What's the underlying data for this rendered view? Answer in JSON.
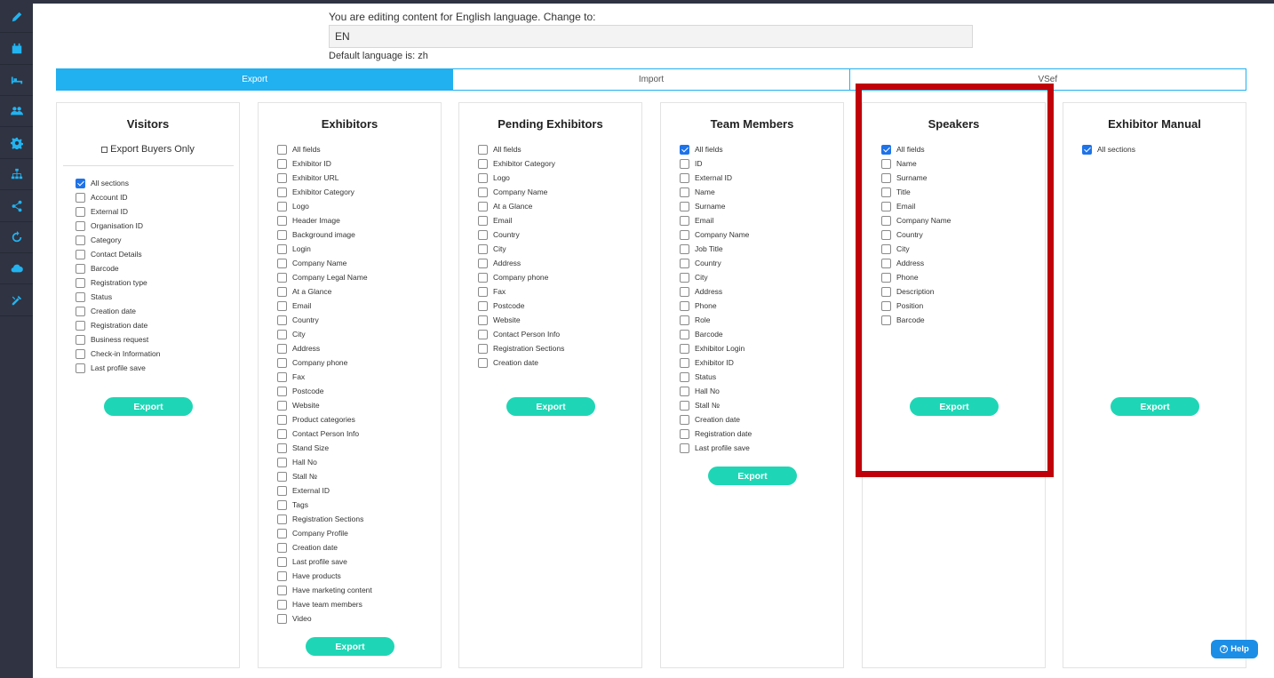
{
  "sidebar": {
    "items": [
      {
        "icon": "pencil-icon"
      },
      {
        "icon": "calendar-icon"
      },
      {
        "icon": "bed-icon"
      },
      {
        "icon": "users-icon"
      },
      {
        "icon": "gear-icon"
      },
      {
        "icon": "sitemap-icon"
      },
      {
        "icon": "share-icon"
      },
      {
        "icon": "refresh-icon"
      },
      {
        "icon": "cloud-upload-icon"
      },
      {
        "icon": "tools-icon"
      }
    ]
  },
  "language": {
    "editing_text": "You are editing content for English language. Change to:",
    "current_value": "EN",
    "default_text": "Default language is: zh"
  },
  "tabs": [
    {
      "label": "Export",
      "active": true
    },
    {
      "label": "Import",
      "active": false
    },
    {
      "label": "VSef",
      "active": false
    }
  ],
  "panels": [
    {
      "key": "visitors",
      "title": "Visitors",
      "buyers_only_label": "Export Buyers Only",
      "fields": [
        {
          "label": "All sections",
          "checked": true
        },
        {
          "label": "Account ID",
          "checked": false
        },
        {
          "label": "External ID",
          "checked": false
        },
        {
          "label": "Organisation ID",
          "checked": false
        },
        {
          "label": "Category",
          "checked": false
        },
        {
          "label": "Contact Details",
          "checked": false
        },
        {
          "label": "Barcode",
          "checked": false
        },
        {
          "label": "Registration type",
          "checked": false
        },
        {
          "label": "Status",
          "checked": false
        },
        {
          "label": "Creation date",
          "checked": false
        },
        {
          "label": "Registration date",
          "checked": false
        },
        {
          "label": "Business request",
          "checked": false
        },
        {
          "label": "Check-in Information",
          "checked": false
        },
        {
          "label": "Last profile save",
          "checked": false
        }
      ],
      "export_label": "Export"
    },
    {
      "key": "exhibitors",
      "title": "Exhibitors",
      "fields": [
        {
          "label": "All fields",
          "checked": false
        },
        {
          "label": "Exhibitor ID",
          "checked": false
        },
        {
          "label": "Exhibitor URL",
          "checked": false
        },
        {
          "label": "Exhibitor Category",
          "checked": false
        },
        {
          "label": "Logo",
          "checked": false
        },
        {
          "label": "Header Image",
          "checked": false
        },
        {
          "label": "Background image",
          "checked": false
        },
        {
          "label": "Login",
          "checked": false
        },
        {
          "label": "Company Name",
          "checked": false
        },
        {
          "label": "Company Legal Name",
          "checked": false
        },
        {
          "label": "At a Glance",
          "checked": false
        },
        {
          "label": "Email",
          "checked": false
        },
        {
          "label": "Country",
          "checked": false
        },
        {
          "label": "City",
          "checked": false
        },
        {
          "label": "Address",
          "checked": false
        },
        {
          "label": "Company phone",
          "checked": false
        },
        {
          "label": "Fax",
          "checked": false
        },
        {
          "label": "Postcode",
          "checked": false
        },
        {
          "label": "Website",
          "checked": false
        },
        {
          "label": "Product categories",
          "checked": false
        },
        {
          "label": "Contact Person Info",
          "checked": false
        },
        {
          "label": "Stand Size",
          "checked": false
        },
        {
          "label": "Hall No",
          "checked": false
        },
        {
          "label": "Stall №",
          "checked": false
        },
        {
          "label": "External ID",
          "checked": false
        },
        {
          "label": "Tags",
          "checked": false
        },
        {
          "label": "Registration Sections",
          "checked": false
        },
        {
          "label": "Company Profile",
          "checked": false
        },
        {
          "label": "Creation date",
          "checked": false
        },
        {
          "label": "Last profile save",
          "checked": false
        },
        {
          "label": "Have products",
          "checked": false
        },
        {
          "label": "Have marketing content",
          "checked": false
        },
        {
          "label": "Have team members",
          "checked": false
        },
        {
          "label": "Video",
          "checked": false
        }
      ],
      "export_label": "Export"
    },
    {
      "key": "pending-exhibitors",
      "title": "Pending Exhibitors",
      "fields": [
        {
          "label": "All fields",
          "checked": false
        },
        {
          "label": "Exhibitor Category",
          "checked": false
        },
        {
          "label": "Logo",
          "checked": false
        },
        {
          "label": "Company Name",
          "checked": false
        },
        {
          "label": "At a Glance",
          "checked": false
        },
        {
          "label": "Email",
          "checked": false
        },
        {
          "label": "Country",
          "checked": false
        },
        {
          "label": "City",
          "checked": false
        },
        {
          "label": "Address",
          "checked": false
        },
        {
          "label": "Company phone",
          "checked": false
        },
        {
          "label": "Fax",
          "checked": false
        },
        {
          "label": "Postcode",
          "checked": false
        },
        {
          "label": "Website",
          "checked": false
        },
        {
          "label": "Contact Person Info",
          "checked": false
        },
        {
          "label": "Registration Sections",
          "checked": false
        },
        {
          "label": "Creation date",
          "checked": false
        }
      ],
      "export_label": "Export"
    },
    {
      "key": "team-members",
      "title": "Team Members",
      "fields": [
        {
          "label": "All fields",
          "checked": true
        },
        {
          "label": "ID",
          "checked": false
        },
        {
          "label": "External ID",
          "checked": false
        },
        {
          "label": "Name",
          "checked": false
        },
        {
          "label": "Surname",
          "checked": false
        },
        {
          "label": "Email",
          "checked": false
        },
        {
          "label": "Company Name",
          "checked": false
        },
        {
          "label": "Job Title",
          "checked": false
        },
        {
          "label": "Country",
          "checked": false
        },
        {
          "label": "City",
          "checked": false
        },
        {
          "label": "Address",
          "checked": false
        },
        {
          "label": "Phone",
          "checked": false
        },
        {
          "label": "Role",
          "checked": false
        },
        {
          "label": "Barcode",
          "checked": false
        },
        {
          "label": "Exhibitor Login",
          "checked": false
        },
        {
          "label": "Exhibitor ID",
          "checked": false
        },
        {
          "label": "Status",
          "checked": false
        },
        {
          "label": "Hall No",
          "checked": false
        },
        {
          "label": "Stall №",
          "checked": false
        },
        {
          "label": "Creation date",
          "checked": false
        },
        {
          "label": "Registration date",
          "checked": false
        },
        {
          "label": "Last profile save",
          "checked": false
        }
      ],
      "export_label": "Export"
    },
    {
      "key": "speakers",
      "title": "Speakers",
      "fields": [
        {
          "label": "All fields",
          "checked": true
        },
        {
          "label": "Name",
          "checked": false
        },
        {
          "label": "Surname",
          "checked": false
        },
        {
          "label": "Title",
          "checked": false
        },
        {
          "label": "Email",
          "checked": false
        },
        {
          "label": "Company Name",
          "checked": false
        },
        {
          "label": "Country",
          "checked": false
        },
        {
          "label": "City",
          "checked": false
        },
        {
          "label": "Address",
          "checked": false
        },
        {
          "label": "Phone",
          "checked": false
        },
        {
          "label": "Description",
          "checked": false
        },
        {
          "label": "Position",
          "checked": false
        },
        {
          "label": "Barcode",
          "checked": false
        }
      ],
      "export_label": "Export"
    },
    {
      "key": "exhibitor-manual",
      "title": "Exhibitor Manual",
      "fields": [
        {
          "label": "All sections",
          "checked": true
        }
      ],
      "export_label": "Export"
    }
  ],
  "help": {
    "label": "Help",
    "icon": "question-circle-icon"
  },
  "colors": {
    "accent": "#21b0f0",
    "export_button": "#1ed6b5",
    "checkbox_checked": "#1e73e8",
    "sidebar": "#2f3342",
    "highlight": "#c0000b"
  }
}
